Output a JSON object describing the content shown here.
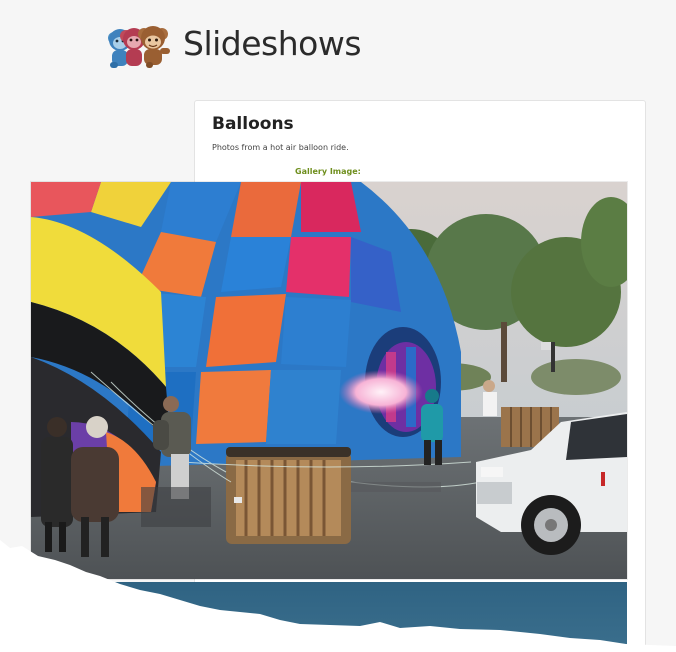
{
  "header": {
    "site_title": "Slideshows",
    "logo_icon": "monkeys-logo-icon"
  },
  "gallery": {
    "title": "Balloons",
    "description": "Photos from a hot air balloon ride.",
    "image_label": "Gallery Image:"
  },
  "colors": {
    "page_background": "#f6f6f6",
    "card_background": "#ffffff",
    "label_green": "#6f8f1e",
    "next_photo_blue": "#2f6383"
  }
}
